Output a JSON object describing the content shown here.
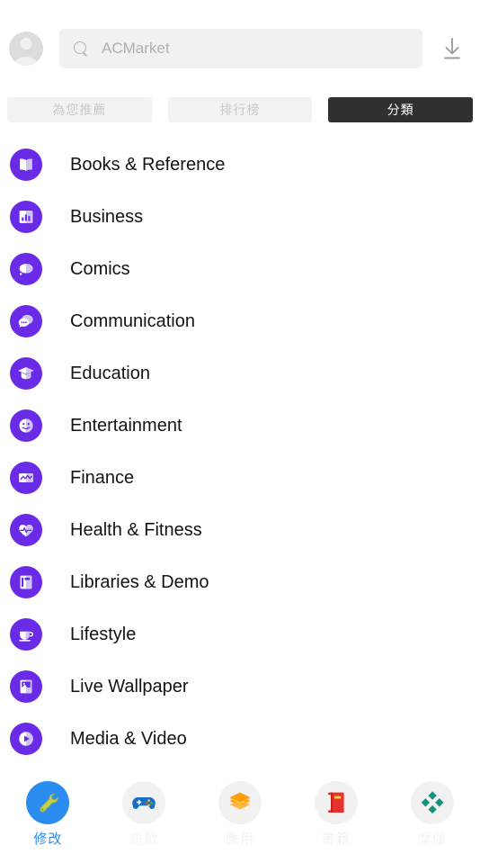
{
  "colors": {
    "category_icon_purple": "#6A2BE6",
    "active_tab_bg": "#303030",
    "inactive_tab_bg": "#F2F2F2",
    "selected_nav_blue": "#2B8CF0",
    "wrench_green": "#C3D14A",
    "gamepad_blue": "#1A6FC4",
    "layers_orange": "#FF9D0B",
    "book_red": "#E8312B",
    "diamond_teal": "#16917F",
    "search_bg": "#F1F1F1"
  },
  "header": {
    "avatar_name": "avatar",
    "search": {
      "placeholder": "ACMarket",
      "value": "",
      "icon": "search-icon"
    },
    "download_icon": "download-icon"
  },
  "tabs": [
    {
      "label": "為您推薦",
      "active": false
    },
    {
      "label": "排行榜",
      "active": false
    },
    {
      "label": "分類",
      "active": true
    }
  ],
  "categories": [
    {
      "label": "Books & Reference",
      "icon": "book-open-icon"
    },
    {
      "label": "Business",
      "icon": "bar-chart-icon"
    },
    {
      "label": "Comics",
      "icon": "speech-bubble-icon"
    },
    {
      "label": "Communication",
      "icon": "chat-bubbles-icon"
    },
    {
      "label": "Education",
      "icon": "graduation-cap-icon"
    },
    {
      "label": "Entertainment",
      "icon": "smiley-face-icon"
    },
    {
      "label": "Finance",
      "icon": "line-graph-icon"
    },
    {
      "label": "Health & Fitness",
      "icon": "heart-pulse-icon"
    },
    {
      "label": "Libraries & Demo",
      "icon": "book-closed-icon"
    },
    {
      "label": "Lifestyle",
      "icon": "coffee-cup-icon"
    },
    {
      "label": "Live Wallpaper",
      "icon": "picture-frame-icon"
    },
    {
      "label": "Media & Video",
      "icon": "play-circle-icon"
    }
  ],
  "bottom_nav": [
    {
      "label": "修改",
      "icon": "wrench-icon",
      "selected": true
    },
    {
      "label": "遊戲",
      "icon": "gamepad-icon",
      "selected": false
    },
    {
      "label": "應用",
      "icon": "layers-icon",
      "selected": false
    },
    {
      "label": "書籍",
      "icon": "book-icon",
      "selected": false
    },
    {
      "label": "摩伽",
      "icon": "diamonds-icon",
      "selected": false
    }
  ]
}
